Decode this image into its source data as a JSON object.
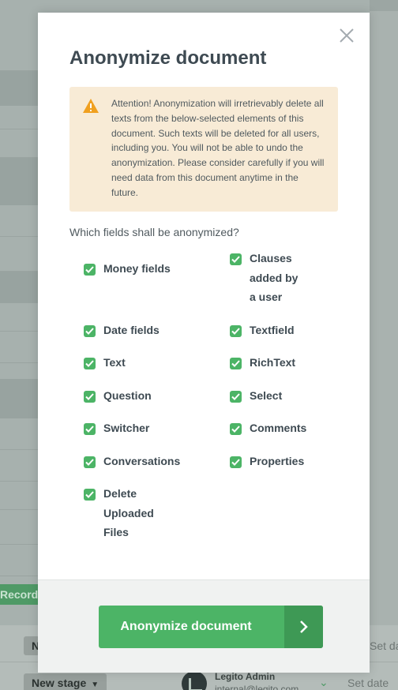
{
  "background": {
    "record_label": "Record",
    "stage_top_label": "N",
    "stage_bottom_label": "New stage",
    "user_name": "Legito Admin",
    "user_email": "internal@legito.com",
    "set_date_label": "Set date"
  },
  "modal": {
    "title": "Anonymize document",
    "alert_text": "Attention! Anonymization will irretrievably delete all texts from the below-selected elements of this document. Such texts will be deleted for all users, including you. You will not be able to undo the anonymization. Please consider carefully if you will need data from this document anytime in the future.",
    "question": "Which fields shall be anonymized?",
    "fields": {
      "money": "Money fields",
      "clauses": "Clauses added by a user",
      "date": "Date fields",
      "textfield": "Textfield",
      "text": "Text",
      "richtext": "RichText",
      "question": "Question",
      "select": "Select",
      "switcher": "Switcher",
      "comments": "Comments",
      "conversations": "Conversations",
      "properties": "Properties",
      "uploaded": "Delete Uploaded Files"
    },
    "submit_label": "Anonymize document"
  },
  "colors": {
    "accent": "#4cb466",
    "accent_dark": "#3e9955",
    "warning_bg": "#f8ebd6",
    "warning_icon": "#f0a020"
  },
  "icons": {
    "close": "close-icon",
    "warning": "warning-icon",
    "check": "checkbox-check-icon",
    "arrow": "chevron-right-icon"
  }
}
